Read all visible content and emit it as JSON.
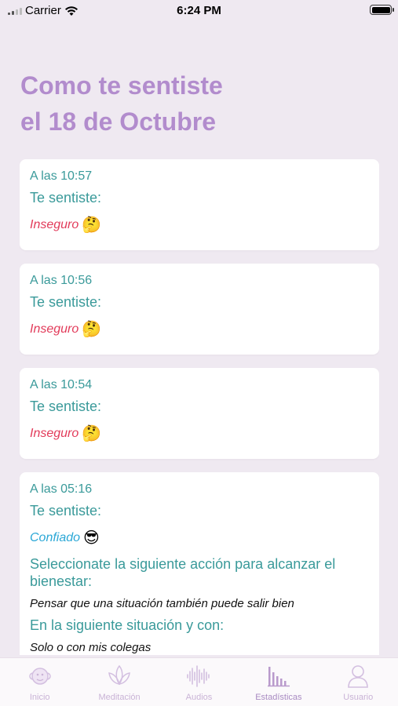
{
  "status_bar": {
    "carrier": "Carrier",
    "time": "6:24 PM"
  },
  "page": {
    "title_line1": "Como te sentiste",
    "title_line2": "el 18 de Octubre"
  },
  "entries": [
    {
      "time": "A las 10:57",
      "label": "Te sentiste:",
      "feeling": "Inseguro",
      "emoji": "🤔"
    },
    {
      "time": "A las 10:56",
      "label": "Te sentiste:",
      "feeling": "Inseguro",
      "emoji": "🤔"
    },
    {
      "time": "A las 10:54",
      "label": "Te sentiste:",
      "feeling": "Inseguro",
      "emoji": "🤔"
    },
    {
      "time": "A las 05:16",
      "label": "Te sentiste:",
      "feeling": "Confiado",
      "emoji": "😎",
      "action_label": "Seleccionate la siguiente acción para alcanzar el bienestar:",
      "action": "Pensar que una situación también puede salir bien",
      "situation_label": "En la siguiente situación y con:",
      "situation": "Solo o con mis colegas"
    }
  ],
  "tabs": [
    {
      "label": "Inicio",
      "icon": "monkey-icon"
    },
    {
      "label": "Meditación",
      "icon": "lotus-icon"
    },
    {
      "label": "Audios",
      "icon": "waveform-icon"
    },
    {
      "label": "Estadísticas",
      "icon": "bar-chart-icon",
      "active": true
    },
    {
      "label": "Usuario",
      "icon": "user-icon"
    }
  ],
  "colors": {
    "title": "#b28ccd",
    "accent": "#3a9a9a",
    "insecure": "#e23b5a",
    "confident": "#2aa7d6",
    "tab": "#c9b3d6"
  }
}
